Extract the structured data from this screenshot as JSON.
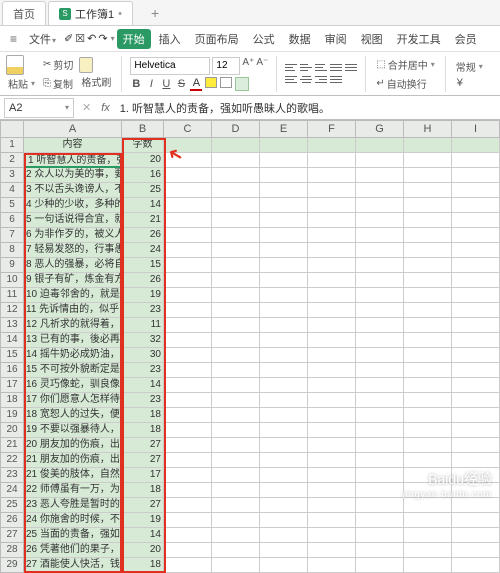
{
  "tabs": {
    "home": "首页",
    "doc": "工作簿1",
    "dirty": "•"
  },
  "menu": {
    "file": "文件",
    "start": "开始",
    "insert": "插入",
    "layout": "页面布局",
    "formula": "公式",
    "data": "数据",
    "review": "审阅",
    "view": "视图",
    "dev": "开发工具",
    "extra": "会员"
  },
  "ribbon": {
    "cut": "剪切",
    "copy": "复制",
    "format_brush": "格式刷",
    "paste": "粘贴",
    "font": "Helvetica",
    "size": "12",
    "merge": "合并居中",
    "wrap": "自动换行",
    "general": "常规"
  },
  "namebox": "A2",
  "formula": "1. 听智慧人的责备，强如听愚昧人的歌唱。",
  "cols": [
    "A",
    "B",
    "C",
    "D",
    "E",
    "F",
    "G",
    "H",
    "I"
  ],
  "headers": {
    "A": "内容",
    "B": "字数"
  },
  "rows": [
    {
      "n": 1,
      "a": "内容",
      "b": "字数",
      "hdr": true
    },
    {
      "n": 2,
      "a": "1 听智慧人的责备，强",
      "b": "20",
      "sel": true
    },
    {
      "n": 3,
      "a": "2 众人以为美的事，要",
      "b": "16"
    },
    {
      "n": 4,
      "a": "3 不以舌头谗谤人，不",
      "b": "25"
    },
    {
      "n": 5,
      "a": "4 少种的少收，多种的",
      "b": "14"
    },
    {
      "n": 6,
      "a": "5 一句话说得合宜，就",
      "b": "21"
    },
    {
      "n": 7,
      "a": "6 为非作歹的，被义人",
      "b": "26"
    },
    {
      "n": 8,
      "a": "7 轻易发怒的，行事愚",
      "b": "24"
    },
    {
      "n": 9,
      "a": "8 恶人的强暴，必将自",
      "b": "15"
    },
    {
      "n": 10,
      "a": "9 银子有矿，炼金有方",
      "b": "26"
    },
    {
      "n": 11,
      "a": "10 迫毒邻舍的，就是",
      "b": "19"
    },
    {
      "n": 12,
      "a": "11 先诉情由的，似乎",
      "b": "23"
    },
    {
      "n": 13,
      "a": "12 凡祈求的就得着，",
      "b": "11"
    },
    {
      "n": 14,
      "a": "13 已有的事，後必再",
      "b": "32"
    },
    {
      "n": 15,
      "a": "14 摇牛奶必成奶油，",
      "b": "30"
    },
    {
      "n": 16,
      "a": "15 不可按外貌断定是",
      "b": "23"
    },
    {
      "n": 17,
      "a": "16 灵巧像蛇，驯良像",
      "b": "14"
    },
    {
      "n": 18,
      "a": "17 你们愿意人怎样待",
      "b": "23"
    },
    {
      "n": 19,
      "a": "18 宽恕人的过失，便",
      "b": "18"
    },
    {
      "n": 20,
      "a": "19 不要以强暴待人，",
      "b": "18"
    },
    {
      "n": 21,
      "a": "20 朋友加的伤痕，出",
      "b": "27"
    },
    {
      "n": 22,
      "a": "21 朋友加的伤痕，出",
      "b": "27"
    },
    {
      "n": 23,
      "a": "21 俊美的肢体，自然",
      "b": "17"
    },
    {
      "n": 24,
      "a": "22 师傅虽有一万，为",
      "b": "18"
    },
    {
      "n": 25,
      "a": "23 恶人夸胜是暂时的",
      "b": "27"
    },
    {
      "n": 26,
      "a": "24 你施舍的时候，不",
      "b": "19"
    },
    {
      "n": 27,
      "a": "25 当面的责备，强如",
      "b": "14"
    },
    {
      "n": 28,
      "a": "26 凭著他们的果子，",
      "b": "20"
    },
    {
      "n": 29,
      "a": "27 酒能使人快活，钱",
      "b": "18"
    }
  ],
  "watermark": {
    "main": "Baidu经验",
    "sub": "jingyan.baidu.com"
  }
}
